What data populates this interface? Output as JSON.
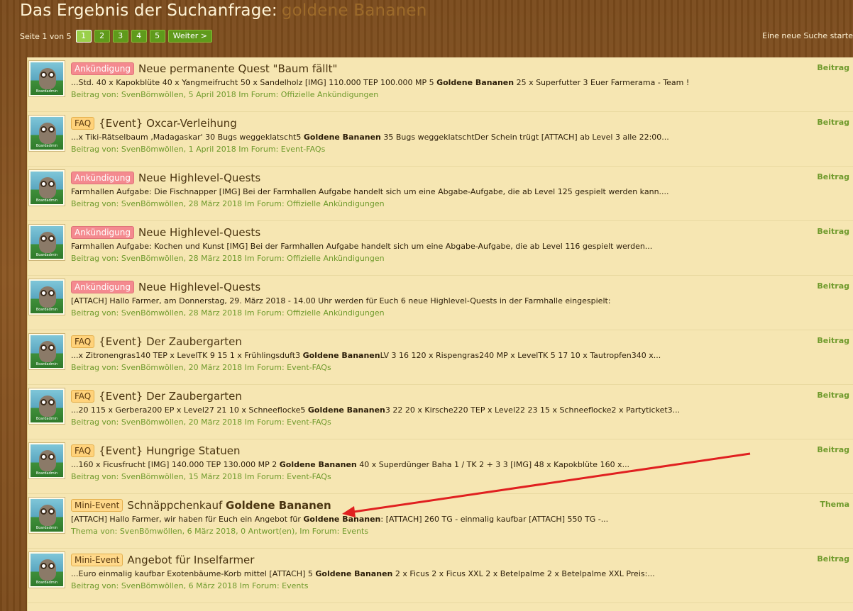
{
  "header": {
    "title": "Das Ergebnis der Suchanfrage:",
    "query": "goldene Bananen"
  },
  "pagination": {
    "label": "Seite 1 von 5",
    "pages": [
      "1",
      "2",
      "3",
      "4",
      "5"
    ],
    "current": "1",
    "next": "Weiter >"
  },
  "new_search": "Eine neue Suche starte",
  "results": [
    {
      "badge": "Ankündigung",
      "title": "Neue permanente Quest \"Baum fällt\"",
      "snippet_pre": "...Std. 40 x Kapokblüte 40 x Yangmeifrucht 50 x Sandelholz [IMG] 110.000 TEP 100.000 MP 5 ",
      "snippet_bold": "Goldene Bananen",
      "snippet_post": " 25 x Superfutter 3 Euer Farmerama - Team !",
      "meta": "Beitrag von: SvenBömwöllen, 5 April 2018 Im Forum: Offizielle Ankündigungen",
      "type": "Beitrag"
    },
    {
      "badge": "FAQ",
      "title": "{Event} Oxcar-Verleihung",
      "snippet_pre": "...x Tiki-Rätselbaum ‚Madagaskar' 30 Bugs weggeklatscht5 ",
      "snippet_bold": "Goldene Bananen",
      "snippet_post": " 35 Bugs weggeklatschtDer Schein trügt [ATTACH] ab Level 3 alle 22:00...",
      "meta": "Beitrag von: SvenBömwöllen, 1 April 2018 Im Forum: Event-FAQs",
      "type": "Beitrag"
    },
    {
      "badge": "Ankündigung",
      "title": "Neue Highlevel-Quests",
      "snippet_pre": "Farmhallen Aufgabe: Die Fischnapper [IMG] Bei der Farmhallen Aufgabe handelt sich um eine Abgabe-Aufgabe, die ab Level 125 gespielt werden kann....",
      "snippet_bold": "",
      "snippet_post": "",
      "meta": "Beitrag von: SvenBömwöllen, 28 März 2018 Im Forum: Offizielle Ankündigungen",
      "type": "Beitrag"
    },
    {
      "badge": "Ankündigung",
      "title": "Neue Highlevel-Quests",
      "snippet_pre": "Farmhallen Aufgabe: Kochen und Kunst [IMG] Bei der Farmhallen Aufgabe handelt sich um eine Abgabe-Aufgabe, die ab Level 116 gespielt werden...",
      "snippet_bold": "",
      "snippet_post": "",
      "meta": "Beitrag von: SvenBömwöllen, 28 März 2018 Im Forum: Offizielle Ankündigungen",
      "type": "Beitrag"
    },
    {
      "badge": "Ankündigung",
      "title": "Neue Highlevel-Quests",
      "snippet_pre": "[ATTACH] Hallo Farmer, am Donnerstag, 29. März 2018 - 14.00 Uhr werden für Euch 6 neue Highlevel-Quests in der Farmhalle eingespielt:",
      "snippet_bold": "",
      "snippet_post": "",
      "meta": "Beitrag von: SvenBömwöllen, 28 März 2018 Im Forum: Offizielle Ankündigungen",
      "type": "Beitrag"
    },
    {
      "badge": "FAQ",
      "title": "{Event} Der Zaubergarten",
      "snippet_pre": "...x Zitronengras140 TEP x LevelTK 9 15 1 x Frühlingsduft3 ",
      "snippet_bold": "Goldene Bananen",
      "snippet_post": "LV 3 16 120 x Rispengras240 MP x LevelTK 5 17 10 x Tautropfen340 x...",
      "meta": "Beitrag von: SvenBömwöllen, 20 März 2018 Im Forum: Event-FAQs",
      "type": "Beitrag"
    },
    {
      "badge": "FAQ",
      "title": "{Event} Der Zaubergarten",
      "snippet_pre": "...20 115 x Gerbera200 EP x Level27 21 10 x Schneeflocke5 ",
      "snippet_bold": "Goldene Bananen",
      "snippet_post": "3 22 20 x Kirsche220 TEP x Level22 23 15 x Schneeflocke2 x Partyticket3...",
      "meta": "Beitrag von: SvenBömwöllen, 20 März 2018 Im Forum: Event-FAQs",
      "type": "Beitrag"
    },
    {
      "badge": "FAQ",
      "title": "{Event} Hungrige Statuen",
      "snippet_pre": "...160 x Ficusfrucht [IMG] 140.000 TEP 130.000 MP 2 ",
      "snippet_bold": "Goldene Bananen",
      "snippet_post": " 40 x Superdünger Baha 1 / TK 2 + 3 3 [IMG] 48 x Kapokblüte 160 x...",
      "meta": "Beitrag von: SvenBömwöllen, 15 März 2018 Im Forum: Event-FAQs",
      "type": "Beitrag"
    },
    {
      "badge": "Mini-Event",
      "title_pre": "Schnäppchenkauf ",
      "title_bold": "Goldene Bananen",
      "snippet_pre": "[ATTACH] Hallo Farmer, wir haben für Euch ein Angebot für ",
      "snippet_bold": "Goldene Bananen",
      "snippet_post": ": [ATTACH] 260 TG - einmalig kaufbar [ATTACH] 550 TG -...",
      "meta": "Thema von: SvenBömwöllen, 6 März 2018, 0 Antwort(en), Im Forum: Events",
      "type": "Thema"
    },
    {
      "badge": "Mini-Event",
      "title": "Angebot für Inselfarmer",
      "snippet_pre": "...Euro einmalig kaufbar Exotenbäume-Korb mittel [ATTACH] 5 ",
      "snippet_bold": "Goldene Bananen",
      "snippet_post": " 2 x Ficus 2 x Ficus XXL 2 x Betelpalme 2 x Betelpalme XXL Preis:...",
      "meta": "Beitrag von: SvenBömwöllen, 6 März 2018 Im Forum: Events",
      "type": "Beitrag"
    }
  ],
  "avatar_label": "Boardadmin",
  "colors": {
    "arrow": "#e02020",
    "badge_announcement": "#f48a8f",
    "badge_faq": "#ffd27a",
    "meta_green": "#6f9a2c"
  }
}
